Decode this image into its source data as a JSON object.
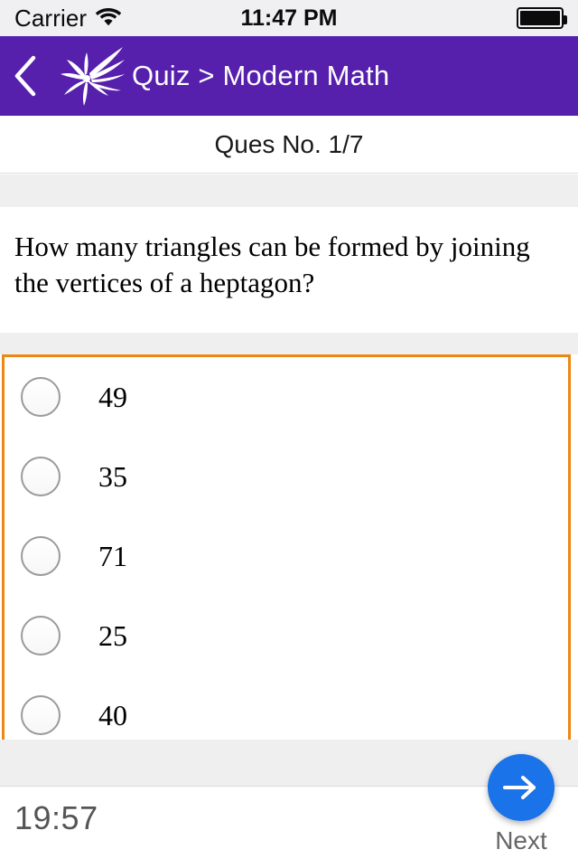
{
  "status_bar": {
    "carrier": "Carrier",
    "time": "11:47 PM",
    "wifi_icon": "wifi-icon",
    "battery_icon": "battery-full-icon"
  },
  "navbar": {
    "back_icon": "chevron-left-icon",
    "logo_icon": "pinwheel-logo-icon",
    "title": "Quiz > Modern Math",
    "background_color": "#5620ad"
  },
  "question_header": {
    "counter": "Ques No. 1/7"
  },
  "question": {
    "text": "How many triangles can be formed by joining the vertices of a heptagon?"
  },
  "options": {
    "border_color": "#ee8712",
    "items": [
      {
        "label": "49",
        "selected": false
      },
      {
        "label": "35",
        "selected": false
      },
      {
        "label": "71",
        "selected": false
      },
      {
        "label": "25",
        "selected": false
      },
      {
        "label": "40",
        "selected": false
      }
    ]
  },
  "footer": {
    "timer": "19:57",
    "next_label": "Next",
    "next_icon": "arrow-right-icon",
    "accent_color": "#1a73e8"
  }
}
